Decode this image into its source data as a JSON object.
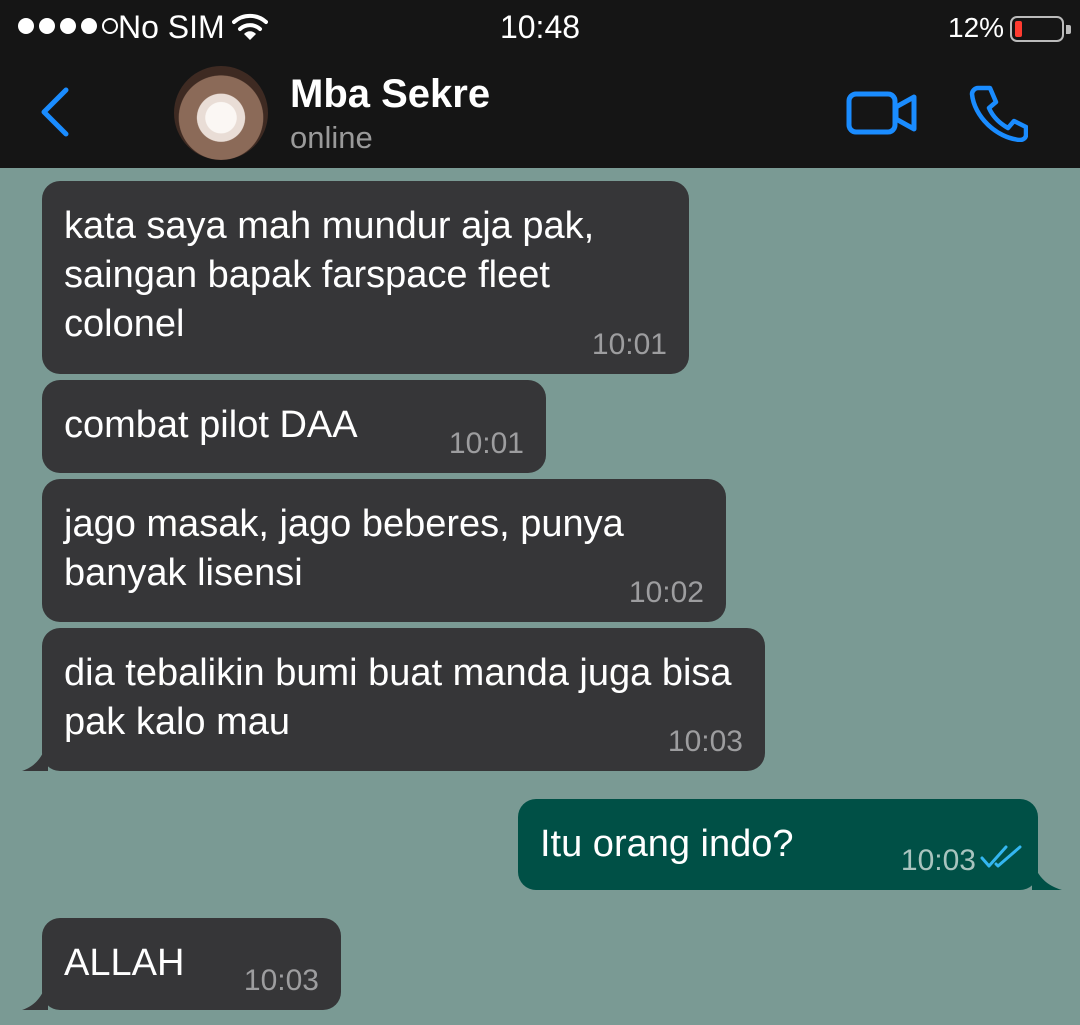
{
  "status_bar": {
    "carrier": "No SIM",
    "time": "10:48",
    "battery_percent": "12%",
    "battery_level": 0.12,
    "icons": [
      "signal-dots-icon",
      "wifi-icon",
      "battery-icon"
    ]
  },
  "header": {
    "contact_name": "Mba Sekre",
    "contact_status": "online",
    "icons": [
      "back-chevron-icon",
      "avatar",
      "video-call-icon",
      "phone-call-icon"
    ]
  },
  "colors": {
    "chat_background": "#7a9a94",
    "incoming_bubble": "#363638",
    "outgoing_bubble": "#005046",
    "accent_blue": "#1a8cff",
    "read_tick": "#34b7f1"
  },
  "messages": [
    {
      "direction": "incoming",
      "text": "kata saya mah mundur aja pak, saingan bapak farspace fleet colonel",
      "time": "10:01"
    },
    {
      "direction": "incoming",
      "text": "combat pilot DAA",
      "time": "10:01"
    },
    {
      "direction": "incoming",
      "text": "jago masak, jago beberes, punya banyak lisensi",
      "time": "10:02"
    },
    {
      "direction": "incoming",
      "text": "dia tebalikin bumi buat manda juga bisa pak kalo mau",
      "time": "10:03"
    },
    {
      "direction": "outgoing",
      "text": "Itu orang indo?",
      "time": "10:03",
      "status": "read"
    },
    {
      "direction": "incoming",
      "text": "ALLAH",
      "time": "10:03"
    }
  ]
}
